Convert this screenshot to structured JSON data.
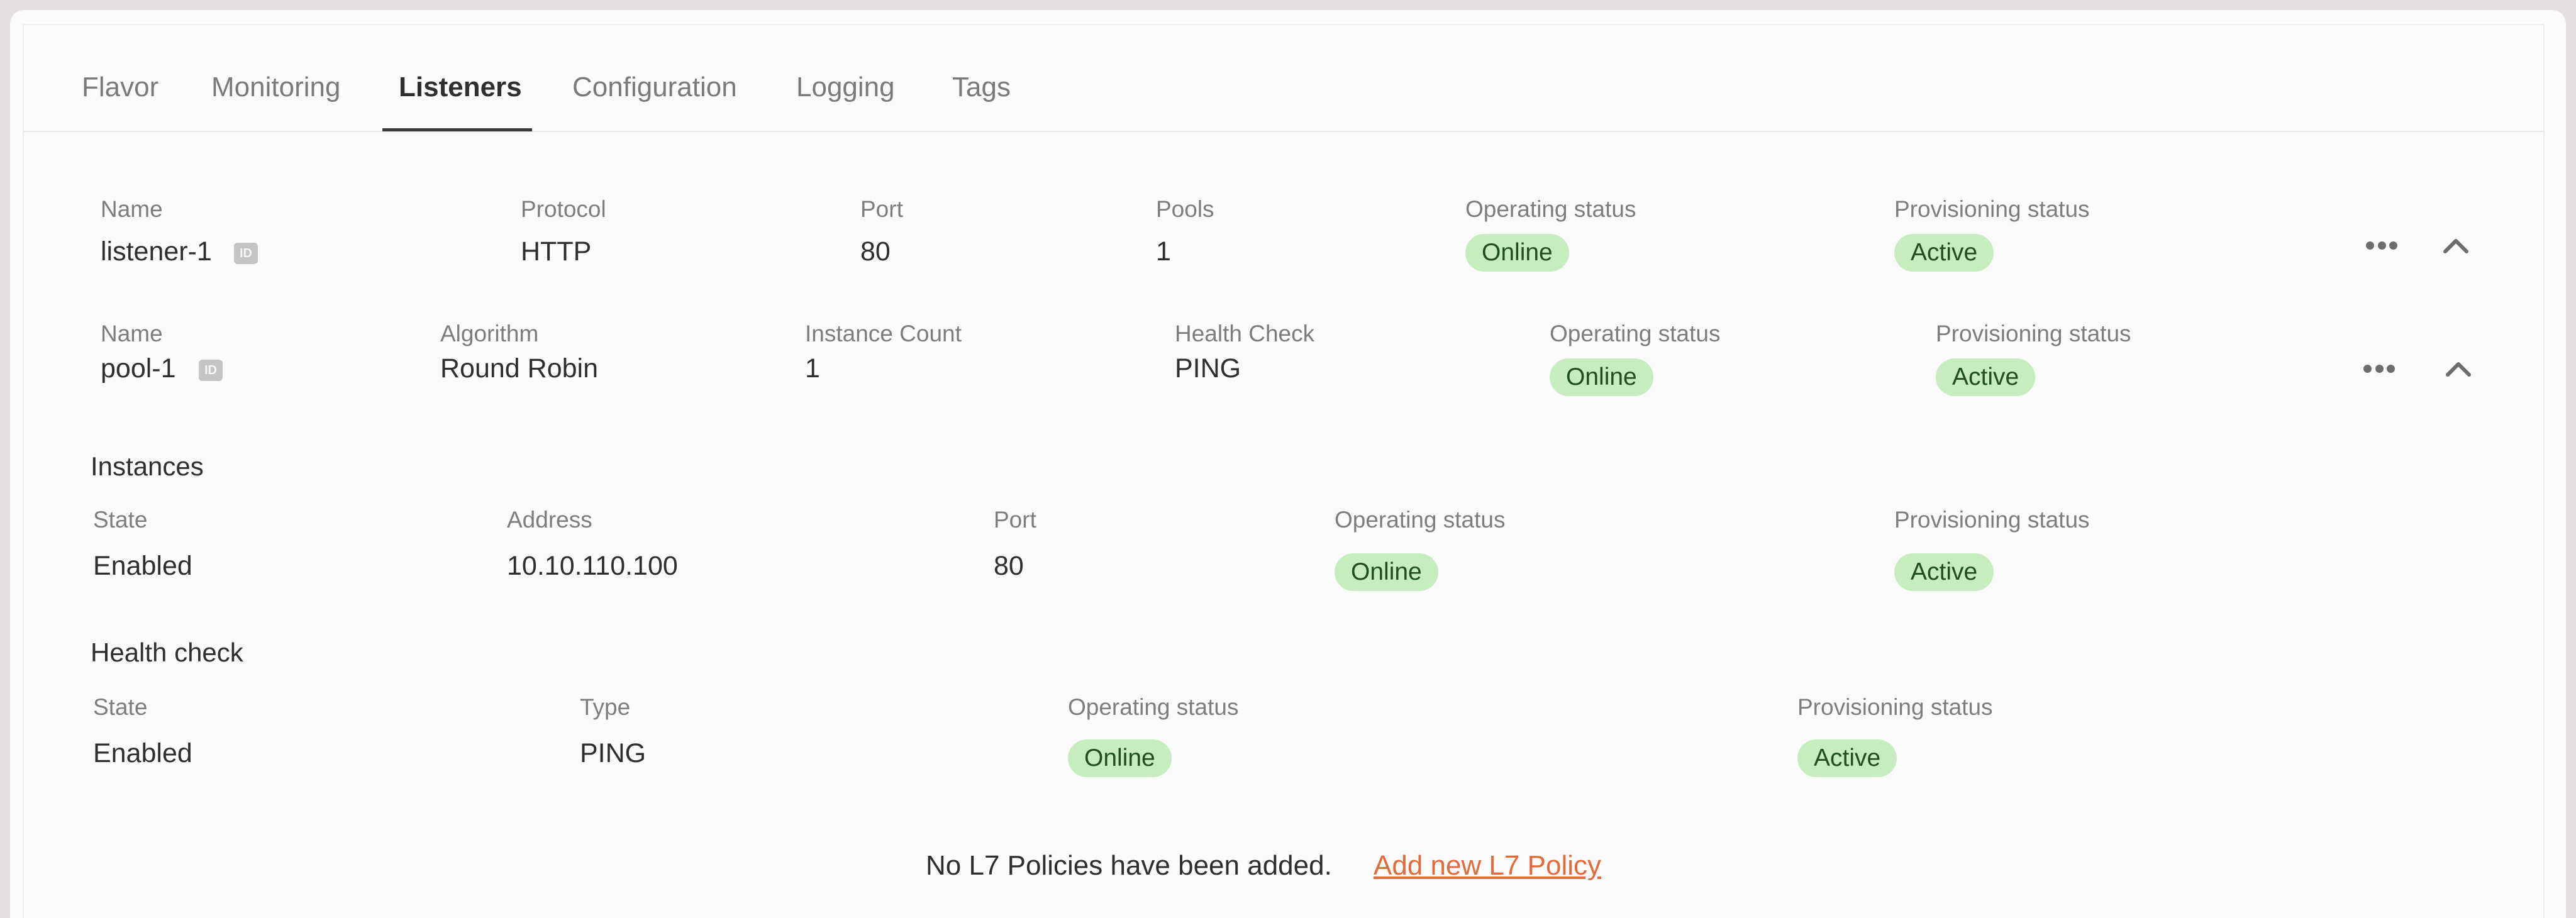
{
  "tabs": [
    {
      "label": "Flavor"
    },
    {
      "label": "Monitoring"
    },
    {
      "label": "Listeners"
    },
    {
      "label": "Configuration"
    },
    {
      "label": "Logging"
    },
    {
      "label": "Tags"
    }
  ],
  "active_tab": "Listeners",
  "listener": {
    "name_label": "Name",
    "name": "listener-1",
    "id_badge": "ID",
    "protocol_label": "Protocol",
    "protocol": "HTTP",
    "port_label": "Port",
    "port": "80",
    "pools_label": "Pools",
    "pools": "1",
    "operating_label": "Operating status",
    "operating": "Online",
    "provisioning_label": "Provisioning status",
    "provisioning": "Active"
  },
  "pool": {
    "name_label": "Name",
    "name": "pool-1",
    "id_badge": "ID",
    "algorithm_label": "Algorithm",
    "algorithm": "Round Robin",
    "instance_count_label": "Instance Count",
    "instance_count": "1",
    "health_check_label": "Health Check",
    "health_check": "PING",
    "operating_label": "Operating status",
    "operating": "Online",
    "provisioning_label": "Provisioning status",
    "provisioning": "Active"
  },
  "instances": {
    "title": "Instances",
    "state_label": "State",
    "state": "Enabled",
    "address_label": "Address",
    "address": "10.10.110.100",
    "port_label": "Port",
    "port": "80",
    "operating_label": "Operating status",
    "operating": "Online",
    "provisioning_label": "Provisioning status",
    "provisioning": "Active"
  },
  "health_check": {
    "title": "Health check",
    "state_label": "State",
    "state": "Enabled",
    "type_label": "Type",
    "type": "PING",
    "operating_label": "Operating status",
    "operating": "Online",
    "provisioning_label": "Provisioning status",
    "provisioning": "Active"
  },
  "l7": {
    "empty_text": "No L7 Policies have been added.",
    "add_link": "Add new L7 Policy"
  },
  "colors": {
    "badge_bg": "#c7ecc0",
    "badge_text": "#1f4f1c",
    "link": "#e46a3c"
  },
  "icons": {
    "more": "more-horizontal-icon",
    "collapse": "chevron-up-icon",
    "id": "id-icon"
  }
}
